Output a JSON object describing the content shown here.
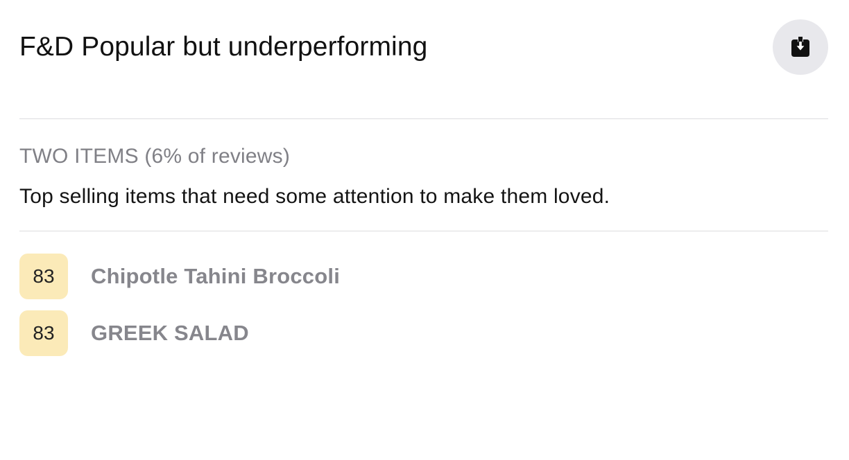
{
  "card": {
    "title": "F&D Popular but underperforming",
    "download_icon": "download-icon"
  },
  "summary": {
    "count_label": "TWO ITEMS (6% of reviews)",
    "description": "Top selling items that need some attention to make them loved."
  },
  "items": [
    {
      "score": "83",
      "name": "Chipotle Tahini Broccoli"
    },
    {
      "score": "83",
      "name": "GREEK SALAD"
    }
  ],
  "colors": {
    "badge_bg": "#fbeab8",
    "item_text": "#86868c",
    "muted_text": "#808086",
    "button_bg": "#e8e8ec"
  }
}
